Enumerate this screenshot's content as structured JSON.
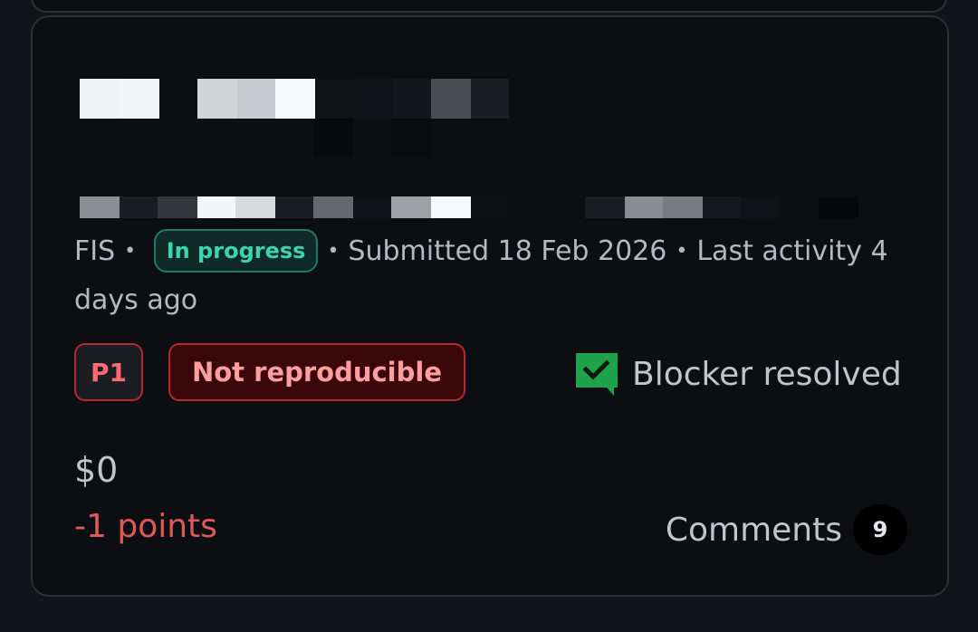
{
  "issue": {
    "team": "FIS",
    "status": "In progress",
    "submitted": "Submitted 18 Feb 2026",
    "last_activity": "Last activity 4 days ago",
    "separator": "•"
  },
  "badges": {
    "priority": "P1",
    "resolution": "Not reproducible"
  },
  "blocker": {
    "icon": "check-chat-icon",
    "label": "Blocker resolved",
    "color": "#1fa34a"
  },
  "reward": {
    "amount": "$0",
    "points": "-1 points"
  },
  "comments": {
    "label": "Comments",
    "count": "9"
  },
  "colors": {
    "status_green": "#3dd3b0",
    "priority_red": "#b52a2f",
    "points_red": "#e0575c"
  }
}
